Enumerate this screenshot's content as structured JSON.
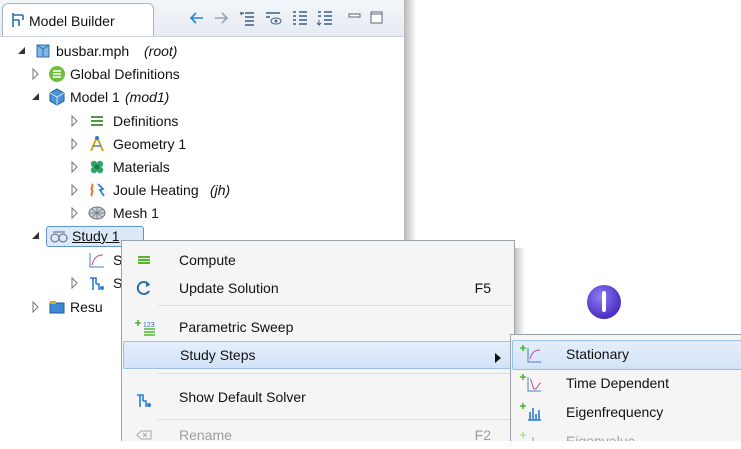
{
  "panel": {
    "tab_title": "Model Builder",
    "toolbar_icons": [
      "back-arrow-icon",
      "forward-arrow-icon",
      "show-icon",
      "hide-icon",
      "expand-sections-icon",
      "collapse-sections-icon",
      "minimize-icon",
      "maximize-icon"
    ]
  },
  "tree": {
    "root": {
      "label": "busbar.mph",
      "tag": "(root)"
    },
    "global_definitions": "Global Definitions",
    "model": {
      "label": "Model 1",
      "tag": "(mod1)"
    },
    "definitions": "Definitions",
    "geometry": "Geometry 1",
    "materials": "Materials",
    "joule": {
      "label": "Joule Heating",
      "tag": "(jh)"
    },
    "mesh": "Mesh 1",
    "study": "Study 1",
    "study_step_stub": "S",
    "solver_stub": "S",
    "results_stub": "Resu"
  },
  "menu": {
    "compute": "Compute",
    "update_solution": "Update Solution",
    "update_shortcut": "F5",
    "parametric_sweep": "Parametric Sweep",
    "study_steps": "Study Steps",
    "show_default_solver": "Show Default Solver",
    "rename": "Rename",
    "rename_shortcut": "F2"
  },
  "submenu": {
    "stationary": "Stationary",
    "time_dependent": "Time Dependent",
    "eigenfrequency": "Eigenfrequency",
    "eigenvalue": "Eigenvalue"
  },
  "colors": {
    "accent": "#3b7fd0",
    "compute_green": "#4fb82e",
    "highlight": "#d3e3f7"
  }
}
